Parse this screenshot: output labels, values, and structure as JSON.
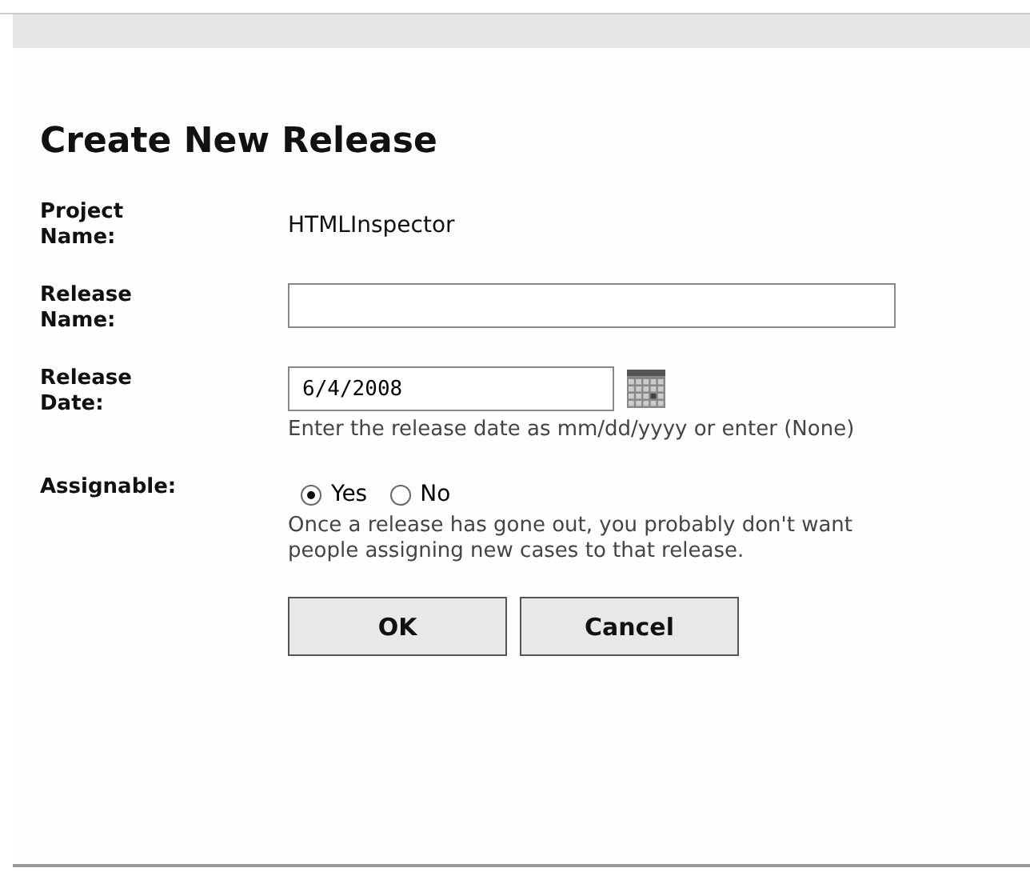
{
  "dialog": {
    "title": "Create New Release",
    "fields": [
      {
        "kind": "text",
        "label": "Project Name:",
        "value": "HTMLInspector"
      },
      {
        "kind": "input",
        "label": "Release Name:"
      },
      {
        "kind": "date",
        "label": "Release Date:",
        "value": "6/4/2008",
        "hint": "Enter the release date as mm/dd/yyyy or enter (None)"
      },
      {
        "kind": "radio",
        "label": "Assignable:",
        "options": [
          {
            "label": "Yes",
            "selected": true
          },
          {
            "label": "No",
            "selected": false
          }
        ],
        "hint": "Once a release has gone out, you probably don't want people assigning new cases to that release."
      }
    ],
    "buttons": [
      "OK",
      "Cancel"
    ]
  }
}
